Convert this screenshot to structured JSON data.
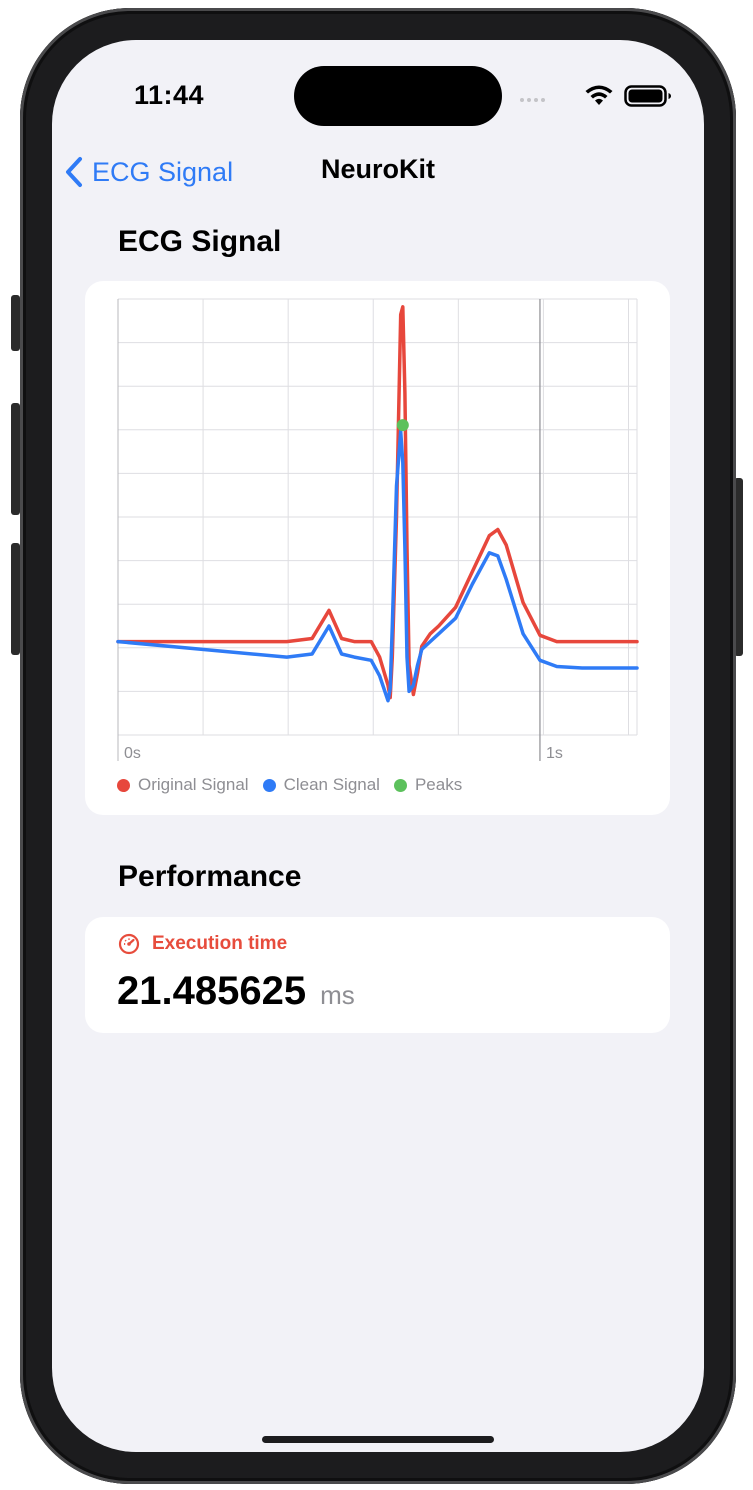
{
  "status_bar": {
    "time": "11:44"
  },
  "nav": {
    "back_label": "ECG Signal",
    "title": "NeuroKit"
  },
  "chart_section": {
    "title": "ECG Signal"
  },
  "chart_data": {
    "type": "line",
    "title": "",
    "xlabel": "",
    "ylabel": "",
    "x_tick_labels": [
      "0s",
      "1s"
    ],
    "xlim": [
      0,
      1.23
    ],
    "ylim": [
      -0.6,
      2.2
    ],
    "grid": true,
    "legend_position": "bottom-left",
    "series": [
      {
        "name": "Original Signal",
        "color": "#e7473c",
        "x": [
          0,
          0.2,
          0.4,
          0.46,
          0.5,
          0.53,
          0.56,
          0.6,
          0.62,
          0.64,
          0.645,
          0.65,
          0.66,
          0.67,
          0.675,
          0.68,
          0.685,
          0.69,
          0.7,
          0.71,
          0.72,
          0.74,
          0.76,
          0.8,
          0.84,
          0.88,
          0.9,
          0.92,
          0.96,
          1.0,
          1.04,
          1.1,
          1.23
        ],
        "y": [
          0.0,
          0.0,
          0.0,
          0.02,
          0.2,
          0.02,
          0.0,
          0.0,
          -0.1,
          -0.28,
          -0.36,
          -0.1,
          0.8,
          2.1,
          2.15,
          1.6,
          0.6,
          -0.15,
          -0.34,
          -0.2,
          -0.03,
          0.05,
          0.1,
          0.22,
          0.45,
          0.68,
          0.72,
          0.62,
          0.25,
          0.04,
          0.0,
          0.0,
          0.0
        ]
      },
      {
        "name": "Clean Signal",
        "color": "#2f7bf6",
        "x": [
          0,
          0.2,
          0.4,
          0.46,
          0.5,
          0.53,
          0.56,
          0.6,
          0.62,
          0.64,
          0.645,
          0.65,
          0.66,
          0.67,
          0.675,
          0.68,
          0.685,
          0.69,
          0.7,
          0.71,
          0.72,
          0.74,
          0.76,
          0.8,
          0.84,
          0.88,
          0.9,
          0.92,
          0.96,
          1.0,
          1.04,
          1.1,
          1.23
        ],
        "y": [
          0.0,
          -0.05,
          -0.1,
          -0.08,
          0.1,
          -0.08,
          -0.1,
          -0.12,
          -0.22,
          -0.38,
          -0.3,
          0.1,
          1.0,
          1.35,
          1.15,
          0.6,
          -0.1,
          -0.32,
          -0.28,
          -0.15,
          -0.05,
          0.0,
          0.05,
          0.15,
          0.37,
          0.57,
          0.55,
          0.4,
          0.05,
          -0.12,
          -0.16,
          -0.17,
          -0.17
        ]
      },
      {
        "name": "Peaks",
        "color": "#5cc15c",
        "x": [
          0.675
        ],
        "y": [
          1.39
        ]
      }
    ]
  },
  "performance_section": {
    "title": "Performance",
    "label": "Execution time",
    "value": "21.485625",
    "unit": "ms"
  },
  "colors": {
    "accent": "#2f7bf6",
    "metric": "#e74c3c",
    "background": "#f2f2f7"
  }
}
